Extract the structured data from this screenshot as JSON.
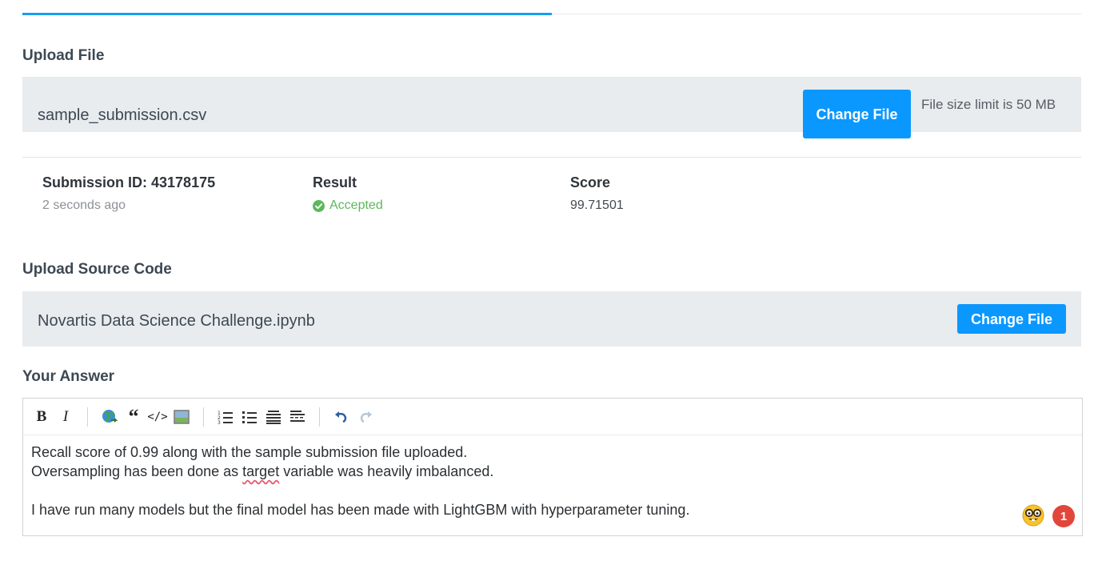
{
  "tabs": {
    "active_index": 0
  },
  "upload_file": {
    "title": "Upload File",
    "file_name": "sample_submission.csv",
    "change_button": "Change File",
    "size_note": "File size limit is 50 MB"
  },
  "submission": {
    "id_label": "Submission ID: 43178175",
    "time_ago": "2 seconds ago",
    "result_label": "Result",
    "result_value": "Accepted",
    "score_label": "Score",
    "score_value": "99.71501"
  },
  "upload_source": {
    "title": "Upload Source Code",
    "file_name": "Novartis Data Science Challenge.ipynb",
    "change_button": "Change File"
  },
  "answer": {
    "title": "Your Answer",
    "toolbar": [
      "bold",
      "italic",
      "link",
      "blockquote",
      "code",
      "image",
      "ordered-list",
      "bulleted-list",
      "heading",
      "horizontal-rule",
      "undo",
      "redo"
    ],
    "line1": "Recall score of 0.99 along with the sample submission file uploaded.",
    "line2_before": "Oversampling has been done as ",
    "line2_misspelled": "target",
    "line2_after": " variable was heavily imbalanced.",
    "line3": "",
    "line4": "I have run many models but the final model has been made with LightGBM with hyperparameter tuning.",
    "badge_count": "1"
  },
  "colors": {
    "accent": "#0a98ff",
    "success": "#5cb85c",
    "badge": "#e2463a",
    "bar_bg": "#e8ecef"
  }
}
